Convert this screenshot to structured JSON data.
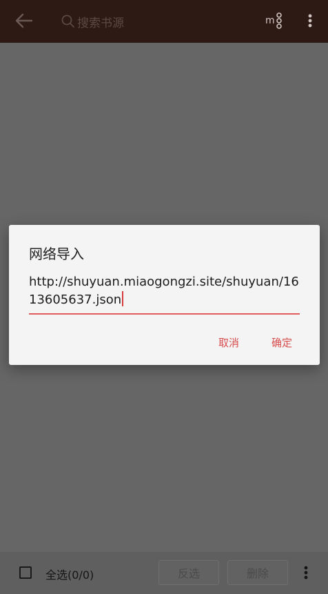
{
  "appbar": {
    "back_icon": "back-arrow-icon",
    "search_placeholder": "搜索书源",
    "group_icon": "group-icon",
    "more_icon": "more-vert-icon"
  },
  "dialog": {
    "title": "网络导入",
    "input_value": "http://shuyuan.miaogongzi.site/shuyuan/1613605637.json",
    "cancel_label": "取消",
    "ok_label": "确定",
    "accent_color": "#e05a5a"
  },
  "bottombar": {
    "select_all_label": "全选(0/0)",
    "invert_label": "反选",
    "delete_label": "删除",
    "more_icon": "more-vert-icon"
  },
  "colors": {
    "scrim": "#666666",
    "toolbar": "#2e1a14",
    "dialog_bg": "#f4f4f4",
    "accent": "#d84d4d"
  }
}
